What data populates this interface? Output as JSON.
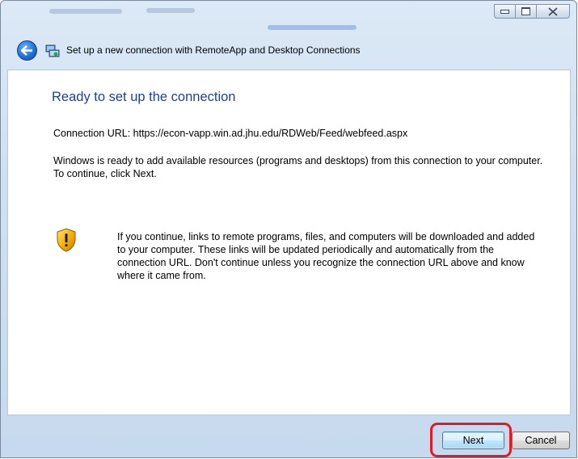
{
  "window": {
    "title": "Set up a new connection with RemoteApp and Desktop Connections",
    "caption_buttons": {
      "minimize_icon": "minimize-icon",
      "maximize_icon": "maximize-icon",
      "close_glyph": "☒"
    }
  },
  "page": {
    "heading": "Ready to set up the connection",
    "connection_url_line": "Connection URL:  https://econ-vapp.win.ad.jhu.edu/RDWeb/Feed/webfeed.aspx",
    "ready_text": "Windows is ready to add available resources (programs and desktops) from this connection to your computer. To continue, click Next.",
    "warning_text": "If you continue, links to remote programs, files, and computers will be downloaded and added to your computer.  These links will be updated periodically and automatically from the connection URL. Don't continue unless you recognize the connection URL above and know where it came from."
  },
  "footer": {
    "next_label": "Next",
    "cancel_label": "Cancel"
  },
  "colors": {
    "heading": "#1e3f9a",
    "highlight": "#e01b24"
  }
}
